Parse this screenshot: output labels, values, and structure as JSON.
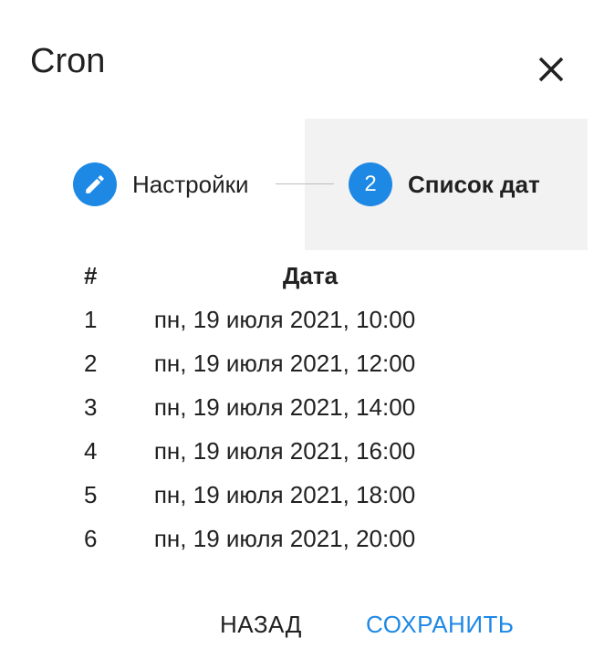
{
  "dialog": {
    "title": "Cron"
  },
  "stepper": {
    "steps": [
      {
        "label": "Настройки",
        "icon": "pencil-icon",
        "state": "completed"
      },
      {
        "label": "Список дат",
        "number": "2",
        "state": "active"
      }
    ]
  },
  "table": {
    "headers": {
      "num": "#",
      "date": "Дата"
    },
    "rows": [
      {
        "num": "1",
        "date": "пн, 19 июля 2021, 10:00"
      },
      {
        "num": "2",
        "date": "пн, 19 июля 2021, 12:00"
      },
      {
        "num": "3",
        "date": "пн, 19 июля 2021, 14:00"
      },
      {
        "num": "4",
        "date": "пн, 19 июля 2021, 16:00"
      },
      {
        "num": "5",
        "date": "пн, 19 июля 2021, 18:00"
      },
      {
        "num": "6",
        "date": "пн, 19 июля 2021, 20:00"
      }
    ]
  },
  "actions": {
    "back_label": "НАЗАД",
    "save_label": "СОХРАНИТЬ"
  },
  "colors": {
    "accent": "#1e88e5",
    "active_step_bg": "#f2f2f2",
    "text": "#212121"
  }
}
